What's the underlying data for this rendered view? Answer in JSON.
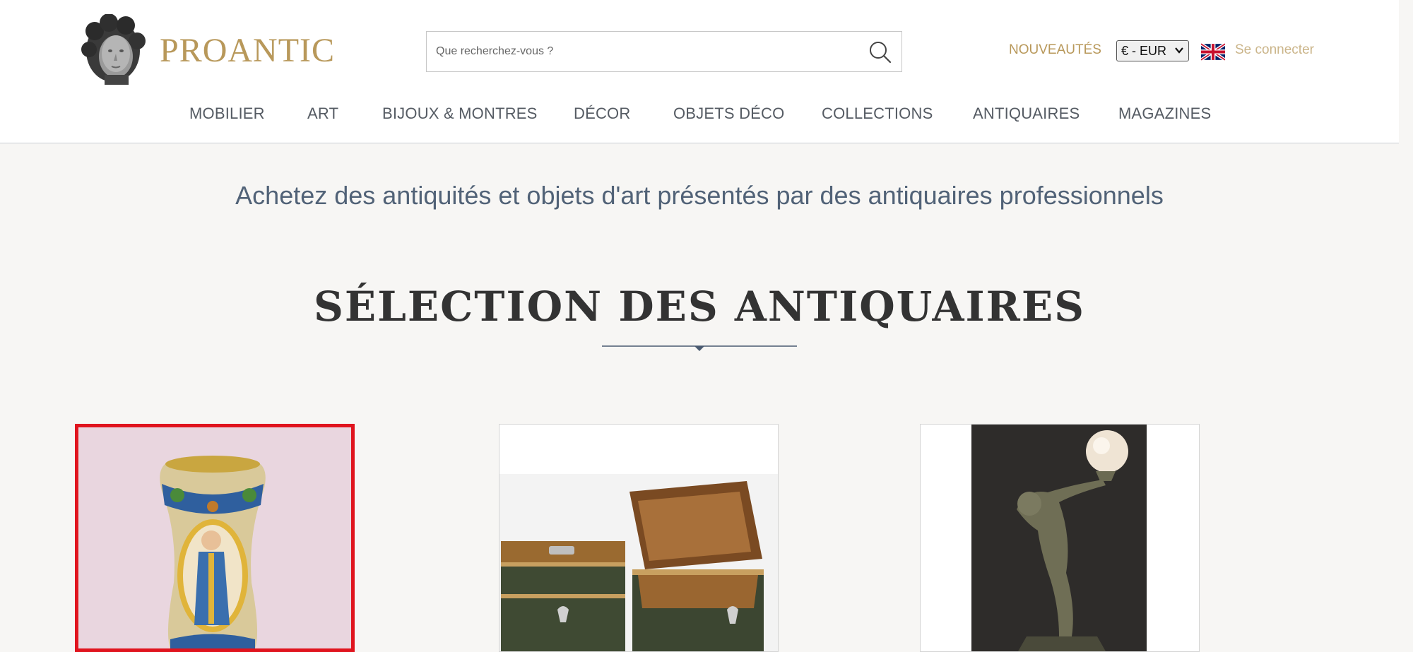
{
  "header": {
    "logo_text": "PROANTIC",
    "search": {
      "placeholder": "Que recherchez-vous ?",
      "value": ""
    },
    "nouveautes_label": "NOUVEAUTÉS",
    "currency_selected": "€ - EUR",
    "language_flag": "uk-flag-icon",
    "login_label": "Se connecter"
  },
  "nav": {
    "items": [
      {
        "label": "MOBILIER"
      },
      {
        "label": "ART"
      },
      {
        "label": "BIJOUX & MONTRES"
      },
      {
        "label": "DÉCOR"
      },
      {
        "label": "OBJETS DÉCO"
      },
      {
        "label": "COLLECTIONS"
      },
      {
        "label": "ANTIQUAIRES"
      },
      {
        "label": "MAGAZINES"
      }
    ]
  },
  "main": {
    "tagline": "Achetez des antiquités et objets d'art présentés par des antiquaires professionnels",
    "section_title": "SÉLECTION DES ANTIQUAIRES",
    "products": [
      {
        "image": "maiolica-albarello-vase"
      },
      {
        "image": "inlaid-wooden-boxes"
      },
      {
        "image": "art-deco-bronze-lamp"
      }
    ]
  },
  "colors": {
    "gold": "#b8985a",
    "navy": "#516277",
    "highlight": "#e0141e"
  }
}
